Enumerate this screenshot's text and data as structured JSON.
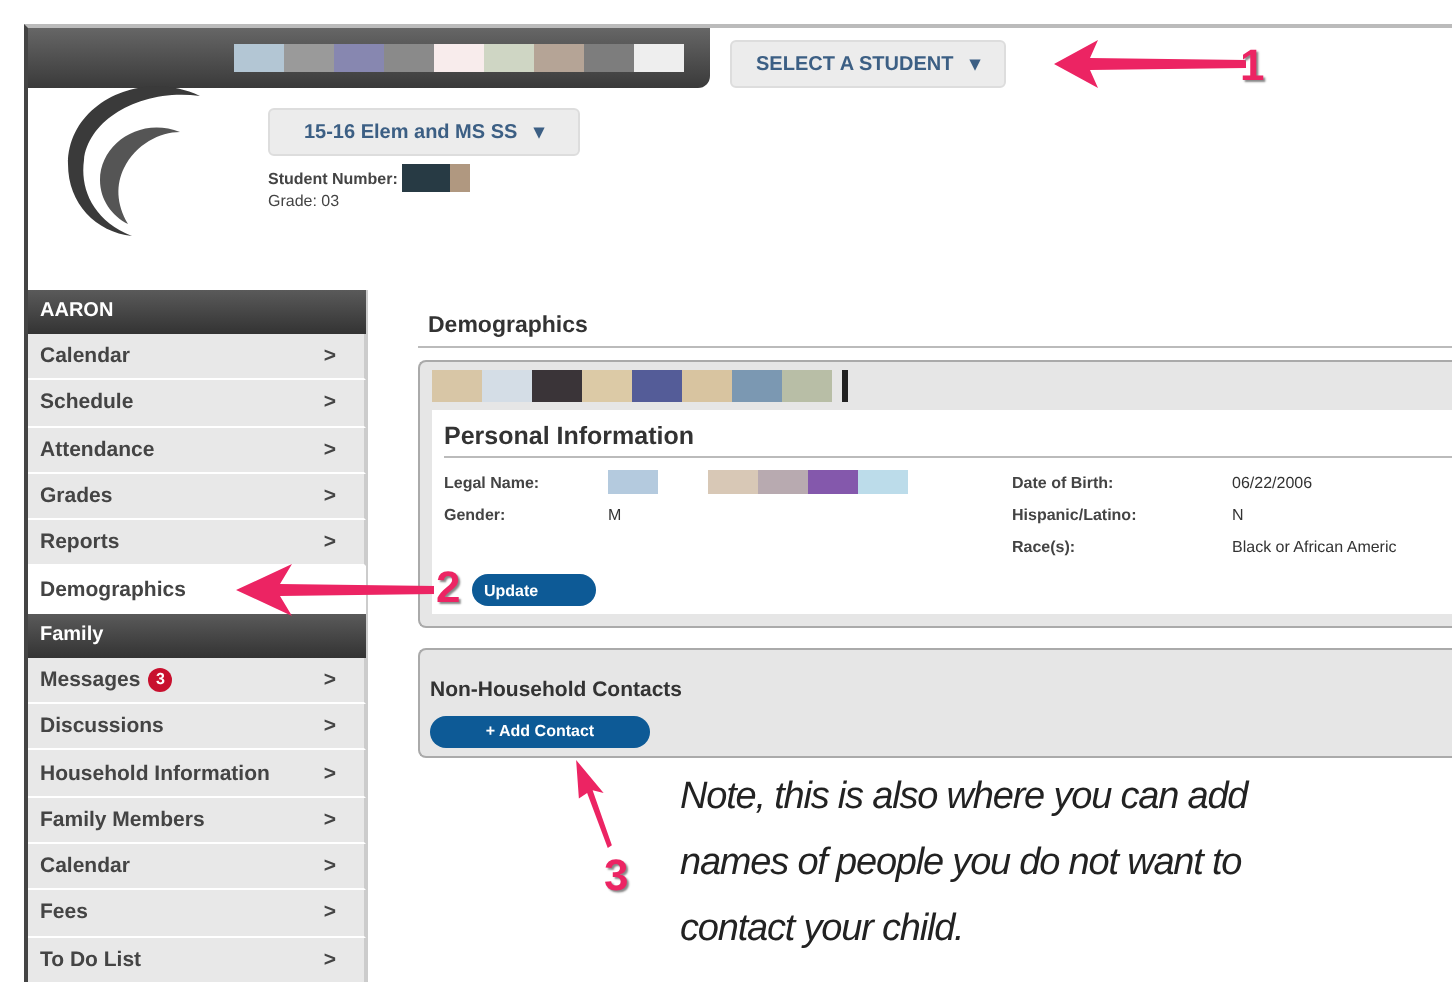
{
  "header": {
    "student_select": {
      "label": "SELECT A STUDENT",
      "caret": "▾"
    }
  },
  "profile": {
    "term_select": {
      "label": "15-16 Elem and MS SS",
      "caret": "▾"
    },
    "student_number_label": "Student Number:",
    "grade": "Grade: 03"
  },
  "sidebar": [
    {
      "title": "AARON",
      "items": [
        {
          "label": "Calendar",
          "chevron": ">",
          "selected": false
        },
        {
          "label": "Schedule",
          "chevron": ">",
          "selected": false
        },
        {
          "label": "Attendance",
          "chevron": ">",
          "selected": false
        },
        {
          "label": "Grades",
          "chevron": ">",
          "selected": false
        },
        {
          "label": "Reports",
          "chevron": ">",
          "selected": false
        },
        {
          "label": "Demographics",
          "selected": true
        }
      ]
    },
    {
      "title": "Family",
      "items": [
        {
          "label": "Messages",
          "badge": "3",
          "chevron": ">",
          "selected": false
        },
        {
          "label": "Discussions",
          "chevron": ">",
          "selected": false
        },
        {
          "label": "Household Information",
          "chevron": ">",
          "selected": false
        },
        {
          "label": "Family Members",
          "chevron": ">",
          "selected": false
        },
        {
          "label": "Calendar",
          "chevron": ">",
          "selected": false
        },
        {
          "label": "Fees",
          "chevron": ">",
          "selected": false
        },
        {
          "label": "To Do List",
          "chevron": ">",
          "selected": false
        }
      ]
    }
  ],
  "main": {
    "title": "Demographics",
    "personal_information": {
      "title": "Personal Information",
      "left_fields": [
        {
          "label": "Legal Name:"
        },
        {
          "label": "Gender:",
          "value": "M"
        }
      ],
      "right_fields": [
        {
          "label": "Date of Birth:",
          "value": "06/22/2006"
        },
        {
          "label": "Hispanic/Latino:",
          "value": "N"
        },
        {
          "label": "Race(s):",
          "value": "Black or African Americ"
        }
      ],
      "button": "Update"
    },
    "non_household_contacts": {
      "title": "Non-Household Contacts",
      "button": "+ Add Contact"
    }
  },
  "annotations": {
    "markers": [
      "1",
      "2",
      "3"
    ],
    "note": "Note, this is also where you can add names of people you do not want to contact your child."
  }
}
